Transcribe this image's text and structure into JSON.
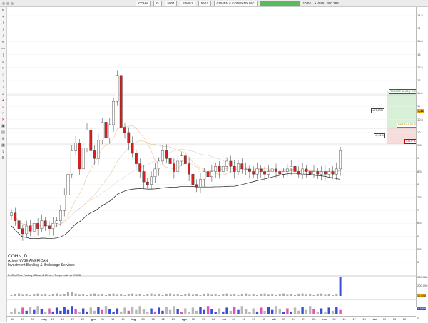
{
  "toolbar": {
    "symbol": "COHN",
    "period": "D",
    "size_a": "500J",
    "size_b": "2.500J",
    "size_c": "550J",
    "company": "COHEN & COMPANY INC",
    "change": "▲ 0,85",
    "price_change_pct": "10,04",
    "volume": "380.788"
  },
  "info": {
    "ticker": "COHN, D",
    "exchange": "Azioni NYSE AMERICAN",
    "industry": "Investment Banking & Brokerage Services",
    "indicator": "ProRealTime Trading - Difesa & 15 min - Tempo reale su 2/30/32"
  },
  "price_axis": [
    "14,5",
    "14",
    "13,5",
    "13",
    "12,5",
    "12",
    "11,5",
    "11",
    "10,5",
    "10",
    "9,5",
    "9",
    "8,5",
    "8",
    "7,5",
    "7",
    "6,5",
    "6",
    "5,5",
    "5"
  ],
  "current_price": "9,30",
  "levels": {
    "target_label": "TARGET 10,85 (+7,25%)",
    "entry_label": "ENTRY 1,00 (9,40)",
    "stop_label": "STOP 8,60",
    "pct_up": "+13,82%",
    "pct_down": "-6,11%"
  },
  "volume_axis": [
    "380.788",
    "200.000",
    "11.888"
  ],
  "osc_axis": [
    "1,7000",
    "0"
  ],
  "date_axis": [
    "11",
    "19",
    "24",
    "mag",
    "10",
    "15",
    "22",
    "29",
    "giu",
    "11",
    "14",
    "19",
    "lug",
    "08",
    "15",
    "22",
    "29",
    "ago",
    "12",
    "19",
    "26",
    "set",
    "09",
    "16",
    "23",
    "30",
    "ott",
    "07",
    "14",
    "21",
    "28",
    "nov",
    "05",
    "10",
    "17",
    "25",
    "dic",
    "09",
    "15",
    "22"
  ],
  "colors": {
    "up": "#ffffff",
    "down": "#d62020",
    "volume": "#3a4fd6",
    "target_zone": "#d8f0d8",
    "stop_zone": "#f7dcdc",
    "ma": "#1a1a1a"
  }
}
